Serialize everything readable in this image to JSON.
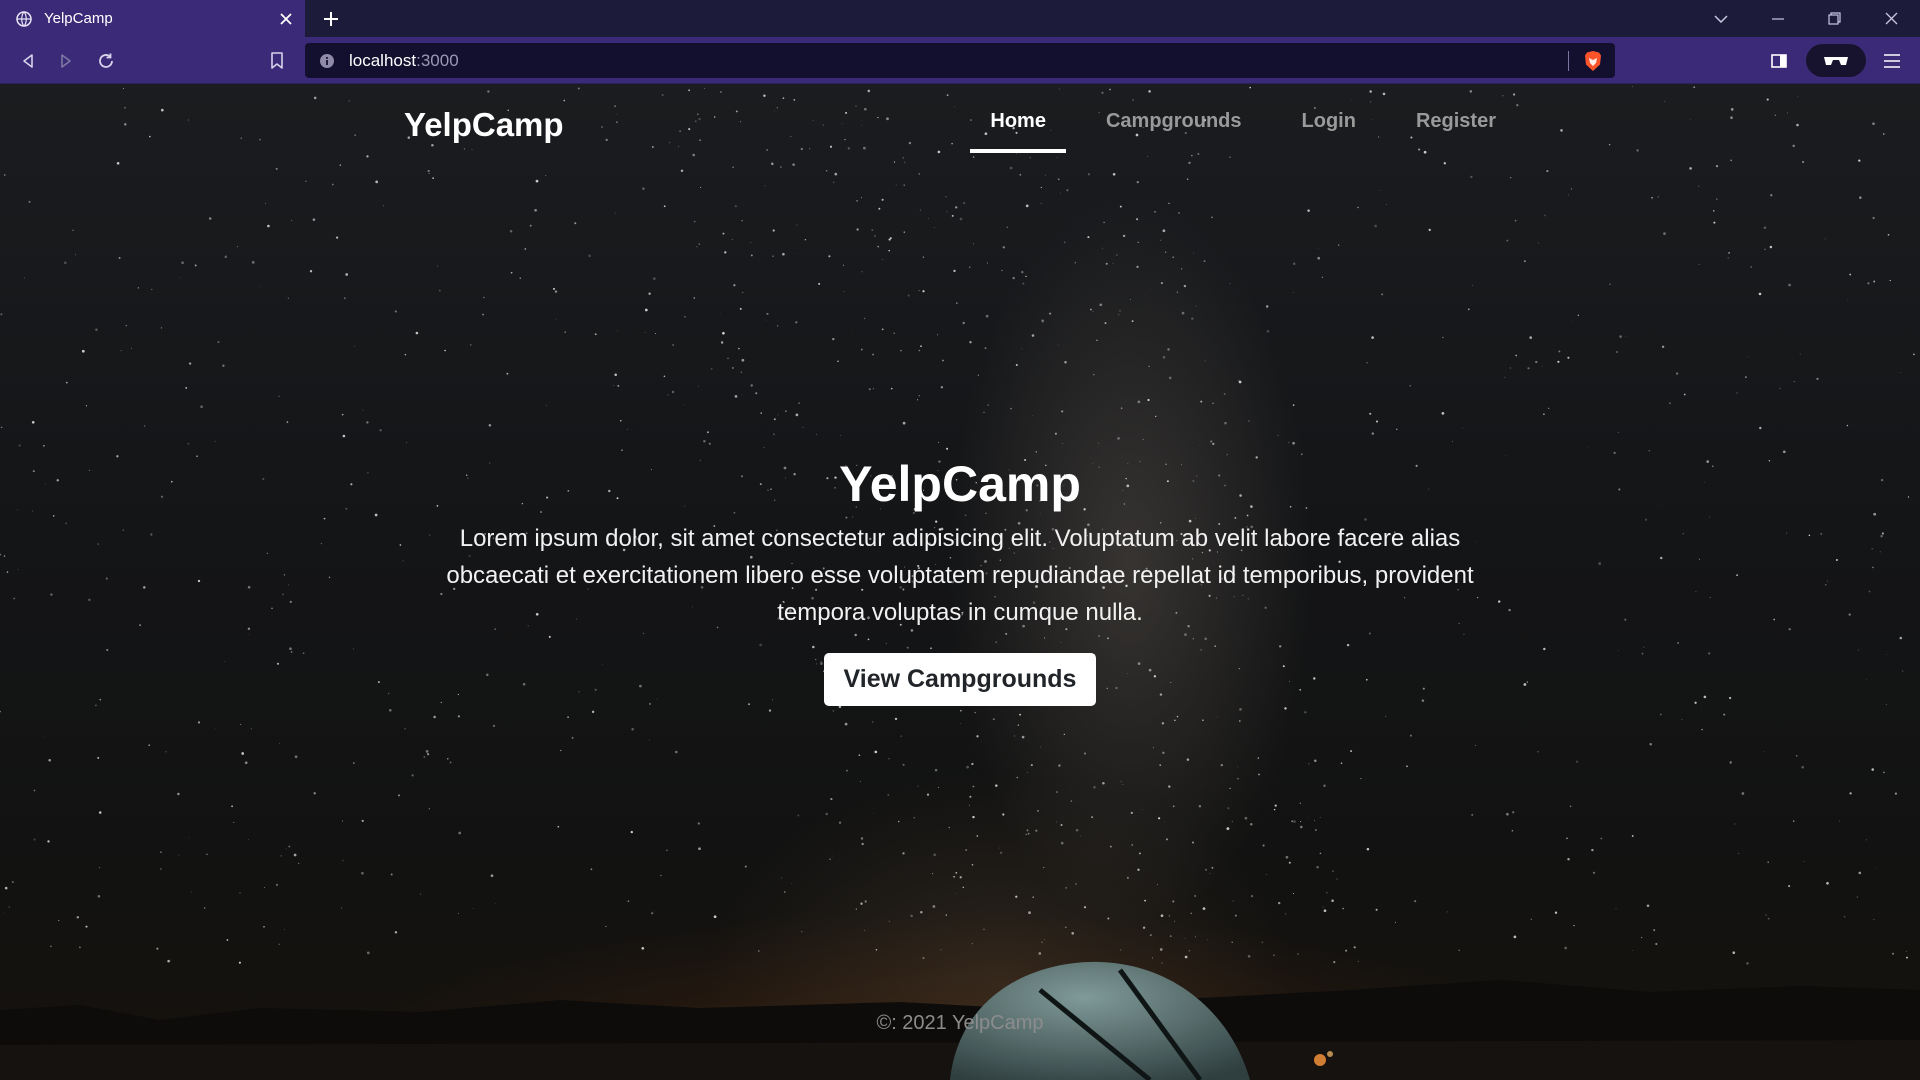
{
  "browser": {
    "tab": {
      "title": "YelpCamp"
    },
    "url": {
      "host": "localhost",
      "port": ":3000"
    },
    "colors": {
      "tab_active": "#3b2a78",
      "tabstrip": "#1d1b3a",
      "urlbar": "#130f2e"
    }
  },
  "nav": {
    "brand": "YelpCamp",
    "links": [
      {
        "label": "Home",
        "active": true
      },
      {
        "label": "Campgrounds",
        "active": false
      },
      {
        "label": "Login",
        "active": false
      },
      {
        "label": "Register",
        "active": false
      }
    ]
  },
  "hero": {
    "title": "YelpCamp",
    "text": "Lorem ipsum dolor, sit amet consectetur adipisicing elit. Voluptatum ab velit labore facere alias obcaecati et exercitationem libero esse voluptatem repudiandae repellat id temporibus, provident tempora voluptas in cumque nulla.",
    "button_label": "View Campgrounds"
  },
  "footer": {
    "text": "©: 2021 YelpCamp"
  }
}
